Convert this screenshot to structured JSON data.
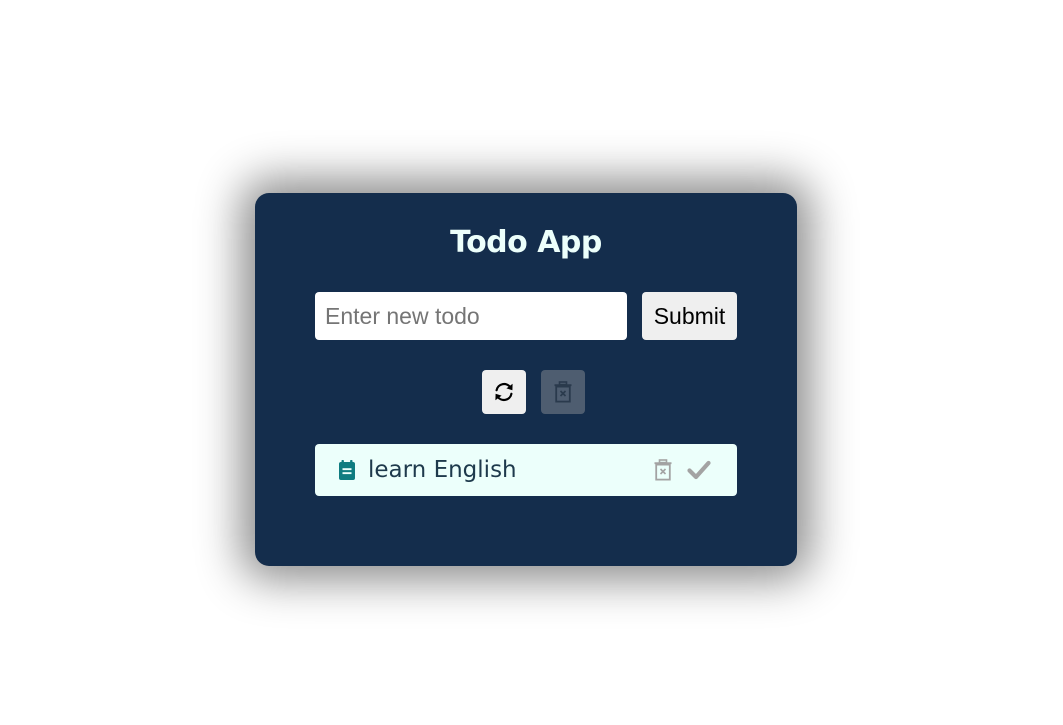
{
  "app": {
    "title": "Todo App"
  },
  "form": {
    "input_value": "",
    "input_placeholder": "Enter new todo",
    "submit_label": "Submit"
  },
  "controls": {
    "refresh_icon": "refresh-icon",
    "clear_all_icon": "trash-x-icon",
    "clear_all_disabled": true
  },
  "todos": [
    {
      "text": "learn English",
      "icon": "clipboard-icon",
      "delete_icon": "trash-x-icon",
      "done_icon": "check-icon"
    }
  ],
  "colors": {
    "card_background": "#142d4c",
    "title_color": "#ecfffb",
    "item_background": "#ecfffb",
    "accent_teal": "#0f7c80",
    "muted_icon": "#a3a3a3"
  }
}
